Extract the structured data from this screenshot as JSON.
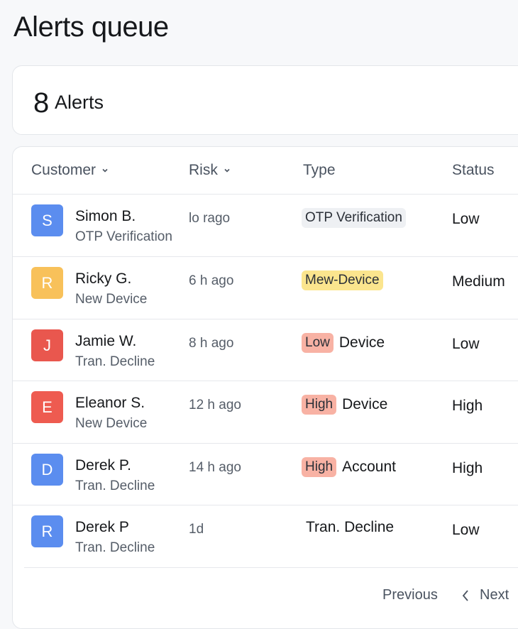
{
  "page": {
    "title": "Alerts queue"
  },
  "summary": {
    "count": "8",
    "label": "Alerts"
  },
  "table": {
    "columns": [
      {
        "label": "Customer",
        "sortable": true
      },
      {
        "label": "Risk",
        "sortable": true
      },
      {
        "label": "Type",
        "sortable": false
      },
      {
        "label": "Status",
        "sortable": false
      }
    ],
    "rows": [
      {
        "initial": "S",
        "avatar_color": "#5b8def",
        "name": "Simon B.",
        "sub": "OTP Verification",
        "time": "lo rago",
        "tag": "OTP Verification",
        "tag_bg": "#eef0f3",
        "tag_color": "#2b3038",
        "type_text": "",
        "status": "Low"
      },
      {
        "initial": "R",
        "avatar_color": "#f8c15a",
        "name": "Ricky G.",
        "sub": "New Device",
        "time": "6 h ago",
        "tag": "Mew-Device",
        "tag_bg": "#fbe58e",
        "tag_color": "#2b3038",
        "type_text": "",
        "status": "Medium"
      },
      {
        "initial": "J",
        "avatar_color": "#e9574e",
        "name": "Jamie W.",
        "sub": "Tran. Decline",
        "time": "8 h ago",
        "tag": "Low",
        "tag_bg": "#f8b2a4",
        "tag_color": "#2b3038",
        "type_text": "Device",
        "status": "Low"
      },
      {
        "initial": "E",
        "avatar_color": "#ee5b50",
        "name": "Eleanor S.",
        "sub": "New Device",
        "time": "12 h ago",
        "tag": "High",
        "tag_bg": "#f8b2a4",
        "tag_color": "#2b3038",
        "type_text": "Device",
        "status": "High"
      },
      {
        "initial": "D",
        "avatar_color": "#5b8def",
        "name": "Derek P.",
        "sub": "Tran. Decline",
        "time": "14 h ago",
        "tag": "High",
        "tag_bg": "#f8b2a4",
        "tag_color": "#2b3038",
        "type_text": "Account",
        "status": "High"
      },
      {
        "initial": "R",
        "avatar_color": "#5b8def",
        "name": "Derek P",
        "sub": "Tran. Decline",
        "time": "1d",
        "tag": "",
        "tag_bg": "",
        "tag_color": "",
        "type_text": "Tran. Decline",
        "status": "Low"
      }
    ]
  },
  "pager": {
    "previous": "Previous",
    "next": "Next"
  }
}
